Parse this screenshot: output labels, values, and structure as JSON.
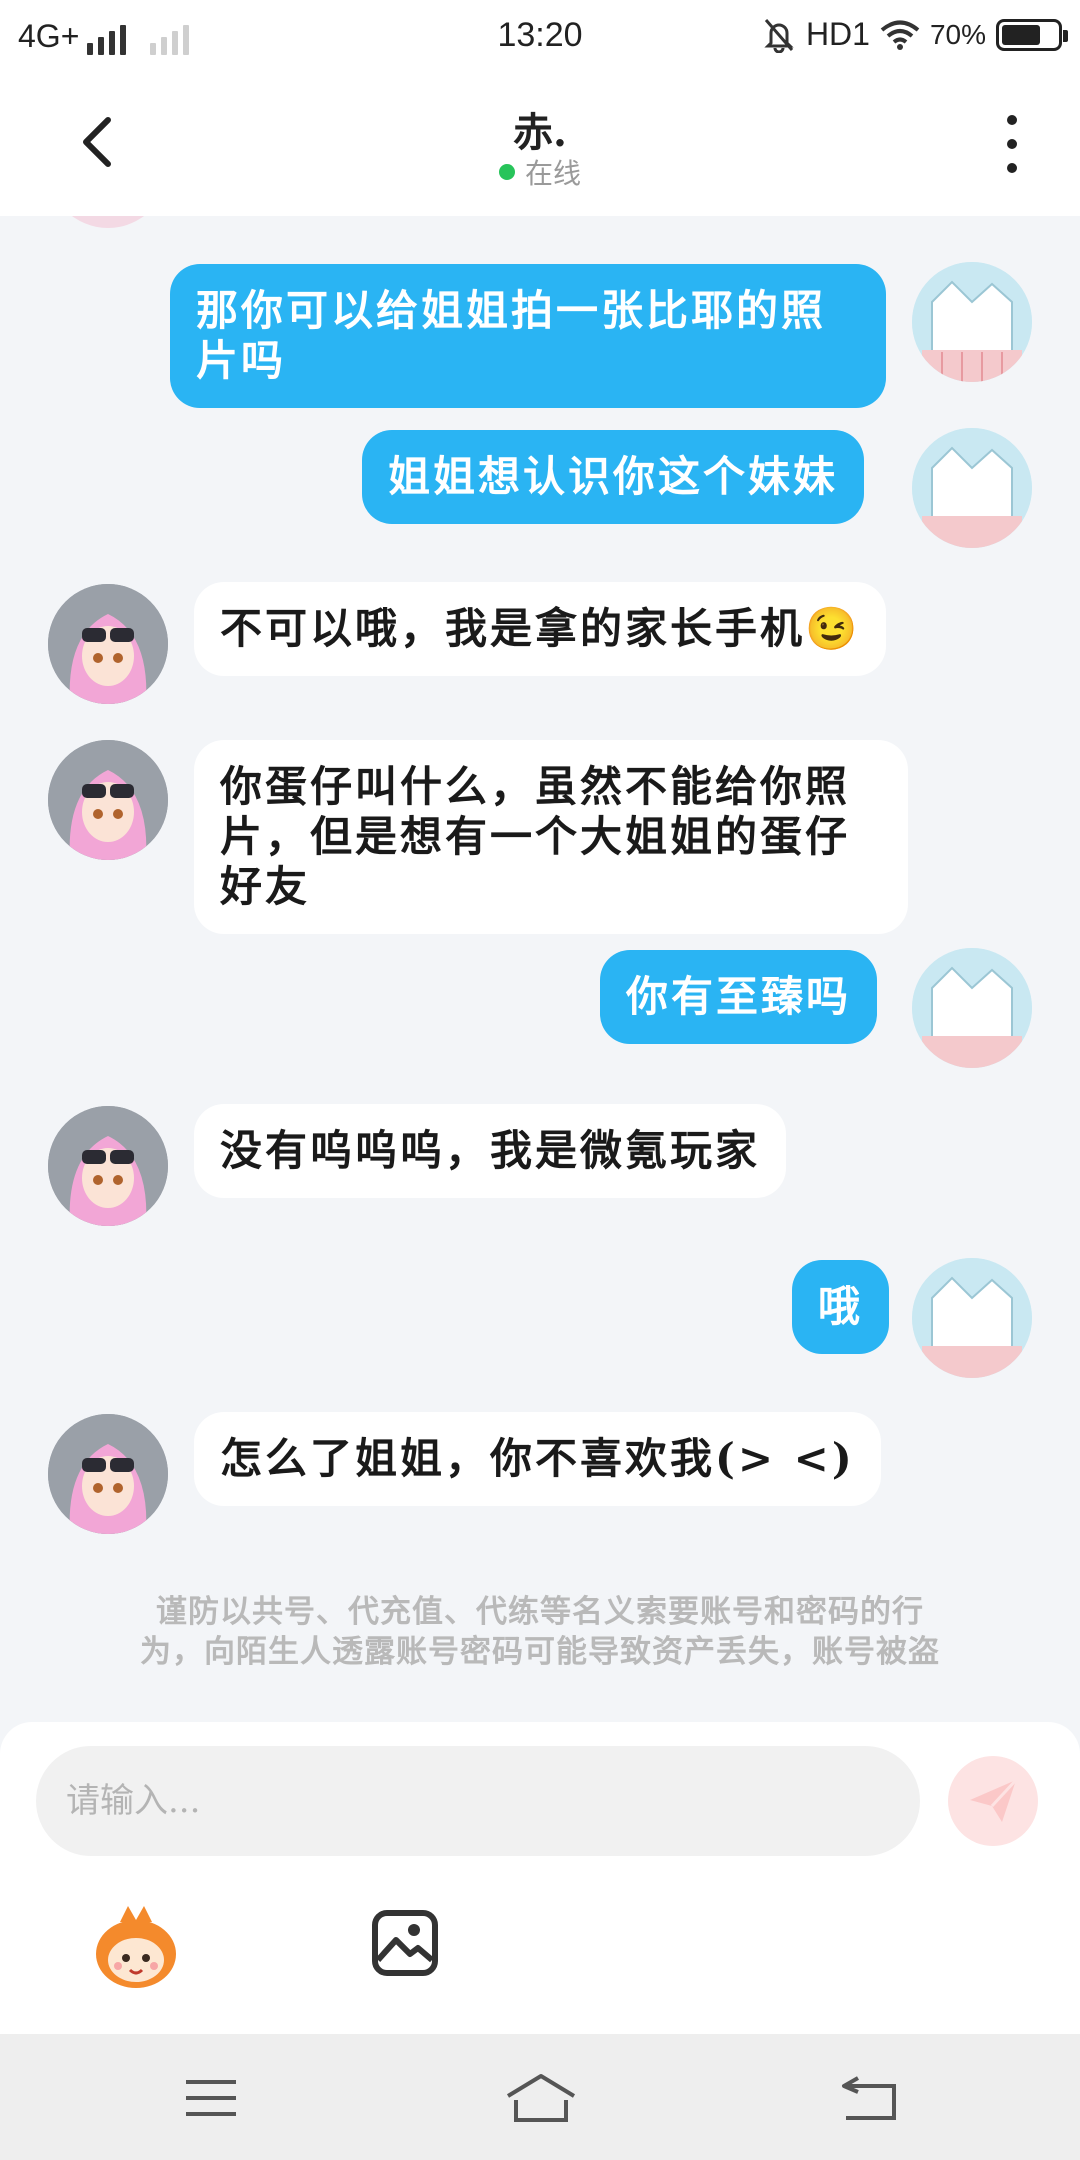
{
  "status_bar": {
    "network": "4G+",
    "time": "13:20",
    "hd": "HD1",
    "battery": "70%",
    "battery_level": 0.7
  },
  "header": {
    "title": "赤.",
    "status": "在线"
  },
  "messages": [
    {
      "sender": "me",
      "lines": [
        "那你可以给姐姐拍一张比耶的照",
        "片吗"
      ]
    },
    {
      "sender": "me",
      "lines": [
        "姐姐想认识你这个妹妹"
      ]
    },
    {
      "sender": "other",
      "lines": [
        "不可以哦，我是拿的家长手机😉"
      ]
    },
    {
      "sender": "other",
      "lines": [
        "你蛋仔叫什么，虽然不能给你照",
        "片，但是想有一个大姐姐的蛋仔",
        "好友"
      ]
    },
    {
      "sender": "me",
      "lines": [
        "你有至臻吗"
      ]
    },
    {
      "sender": "other",
      "lines": [
        "没有呜呜呜，我是微氪玩家"
      ]
    },
    {
      "sender": "me",
      "lines": [
        "哦"
      ]
    },
    {
      "sender": "other",
      "lines": [
        "怎么了姐姐，你不喜欢我(> <)"
      ]
    }
  ],
  "notice": {
    "line1": "谨防以共号、代充值、代练等名义索要账号和密码的行",
    "line2": "为，向陌生人透露账号密码可能导致资产丢失，账号被盗"
  },
  "input": {
    "placeholder": "请输入..."
  },
  "colors": {
    "my_bubble": "#2ab4f3",
    "other_bubble": "#ffffff",
    "background": "#f3f5f8",
    "online": "#27c45a"
  }
}
